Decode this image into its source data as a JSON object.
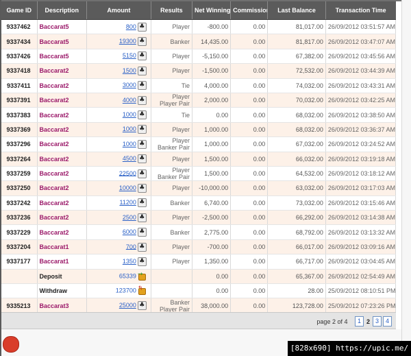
{
  "table": {
    "headers": [
      "Game ID",
      "Description",
      "Amount",
      "Results",
      "Net Winnings",
      "Commission",
      "Last Balance",
      "Transaction Time"
    ],
    "rows": [
      {
        "game_id": "9337462",
        "description": "Baccarat5",
        "amount": "800",
        "results": [
          "Player"
        ],
        "net": "-800.00",
        "commission": "0.00",
        "balance": "81,017.00",
        "time": "26/09/2012 03:51:57 AM",
        "icon": "spade-icon"
      },
      {
        "game_id": "9337434",
        "description": "Baccarat5",
        "amount": "19300",
        "results": [
          "Banker"
        ],
        "net": "14,435.00",
        "commission": "0.00",
        "balance": "81,817.00",
        "time": "26/09/2012 03:47:07 AM",
        "icon": "spade-icon"
      },
      {
        "game_id": "9337426",
        "description": "Baccarat5",
        "amount": "5150",
        "results": [
          "Player"
        ],
        "net": "-5,150.00",
        "commission": "0.00",
        "balance": "67,382.00",
        "time": "26/09/2012 03:45:56 AM",
        "icon": "spade-icon"
      },
      {
        "game_id": "9337418",
        "description": "Baccarat2",
        "amount": "1500",
        "results": [
          "Player"
        ],
        "net": "-1,500.00",
        "commission": "0.00",
        "balance": "72,532.00",
        "time": "26/09/2012 03:44:39 AM",
        "icon": "spade-icon"
      },
      {
        "game_id": "9337411",
        "description": "Baccarat2",
        "amount": "3000",
        "results": [
          "Tie"
        ],
        "net": "4,000.00",
        "commission": "0.00",
        "balance": "74,032.00",
        "time": "26/09/2012 03:43:31 AM",
        "icon": "spade-icon"
      },
      {
        "game_id": "9337391",
        "description": "Baccarat2",
        "amount": "4000",
        "results": [
          "Player",
          "Player Pair"
        ],
        "net": "2,000.00",
        "commission": "0.00",
        "balance": "70,032.00",
        "time": "26/09/2012 03:42:25 AM",
        "icon": "spade-icon"
      },
      {
        "game_id": "9337383",
        "description": "Baccarat2",
        "amount": "1000",
        "results": [
          "Tie"
        ],
        "net": "0.00",
        "commission": "0.00",
        "balance": "68,032.00",
        "time": "26/09/2012 03:38:50 AM",
        "icon": "spade-icon"
      },
      {
        "game_id": "9337369",
        "description": "Baccarat2",
        "amount": "1000",
        "results": [
          "Player"
        ],
        "net": "1,000.00",
        "commission": "0.00",
        "balance": "68,032.00",
        "time": "26/09/2012 03:36:37 AM",
        "icon": "spade-icon"
      },
      {
        "game_id": "9337296",
        "description": "Baccarat2",
        "amount": "1000",
        "results": [
          "Player",
          "Banker Pair"
        ],
        "net": "1,000.00",
        "commission": "0.00",
        "balance": "67,032.00",
        "time": "26/09/2012 03:24:52 AM",
        "icon": "spade-icon"
      },
      {
        "game_id": "9337264",
        "description": "Baccarat2",
        "amount": "4500",
        "results": [
          "Player"
        ],
        "net": "1,500.00",
        "commission": "0.00",
        "balance": "66,032.00",
        "time": "26/09/2012 03:19:18 AM",
        "icon": "spade-icon"
      },
      {
        "game_id": "9337259",
        "description": "Baccarat2",
        "amount": "22500",
        "results": [
          "Player",
          "Banker Pair"
        ],
        "net": "1,500.00",
        "commission": "0.00",
        "balance": "64,532.00",
        "time": "26/09/2012 03:18:12 AM",
        "icon": "spade-icon"
      },
      {
        "game_id": "9337250",
        "description": "Baccarat2",
        "amount": "10000",
        "results": [
          "Player"
        ],
        "net": "-10,000.00",
        "commission": "0.00",
        "balance": "63,032.00",
        "time": "26/09/2012 03:17:03 AM",
        "icon": "spade-icon"
      },
      {
        "game_id": "9337242",
        "description": "Baccarat2",
        "amount": "11200",
        "results": [
          "Banker"
        ],
        "net": "6,740.00",
        "commission": "0.00",
        "balance": "73,032.00",
        "time": "26/09/2012 03:15:46 AM",
        "icon": "spade-icon"
      },
      {
        "game_id": "9337236",
        "description": "Baccarat2",
        "amount": "2500",
        "results": [
          "Player"
        ],
        "net": "-2,500.00",
        "commission": "0.00",
        "balance": "66,292.00",
        "time": "26/09/2012 03:14:38 AM",
        "icon": "spade-icon"
      },
      {
        "game_id": "9337229",
        "description": "Baccarat2",
        "amount": "6000",
        "results": [
          "Banker"
        ],
        "net": "2,775.00",
        "commission": "0.00",
        "balance": "68,792.00",
        "time": "26/09/2012 03:13:32 AM",
        "icon": "spade-icon"
      },
      {
        "game_id": "9337204",
        "description": "Baccarat1",
        "amount": "700",
        "results": [
          "Player"
        ],
        "net": "-700.00",
        "commission": "0.00",
        "balance": "66,017.00",
        "time": "26/09/2012 03:09:16 AM",
        "icon": "spade-icon"
      },
      {
        "game_id": "9337177",
        "description": "Baccarat1",
        "amount": "1350",
        "results": [
          "Player"
        ],
        "net": "1,350.00",
        "commission": "0.00",
        "balance": "66,717.00",
        "time": "26/09/2012 03:04:45 AM",
        "icon": "spade-icon"
      },
      {
        "game_id": "",
        "description": "Deposit",
        "amount": "65339",
        "results": [],
        "net": "0.00",
        "commission": "0.00",
        "balance": "65,367.00",
        "time": "26/09/2012 02:54:49 AM",
        "icon": "deposit-icon"
      },
      {
        "game_id": "",
        "description": "Withdraw",
        "amount": "123700",
        "results": [],
        "net": "0.00",
        "commission": "0.00",
        "balance": "28.00",
        "time": "25/09/2012 08:10:51 PM",
        "icon": "withdraw-icon"
      },
      {
        "game_id": "9335213",
        "description": "Baccarat3",
        "amount": "25000",
        "results": [
          "Banker",
          "Player Pair"
        ],
        "net": "38,000.00",
        "commission": "0.00",
        "balance": "123,728.00",
        "time": "25/09/2012 07:23:26 PM",
        "icon": "spade-icon"
      }
    ]
  },
  "pager": {
    "text": "page 2 of 4",
    "links": [
      "1",
      "2",
      "3",
      "4"
    ],
    "current": "2"
  },
  "watermark": "[828x690] https://upic.me/",
  "colors": {
    "header_bg": "#5b5b5b",
    "row_even": "#fdf1e8",
    "game_link": "#9b1a6a",
    "amount_link": "#2b61c7"
  }
}
